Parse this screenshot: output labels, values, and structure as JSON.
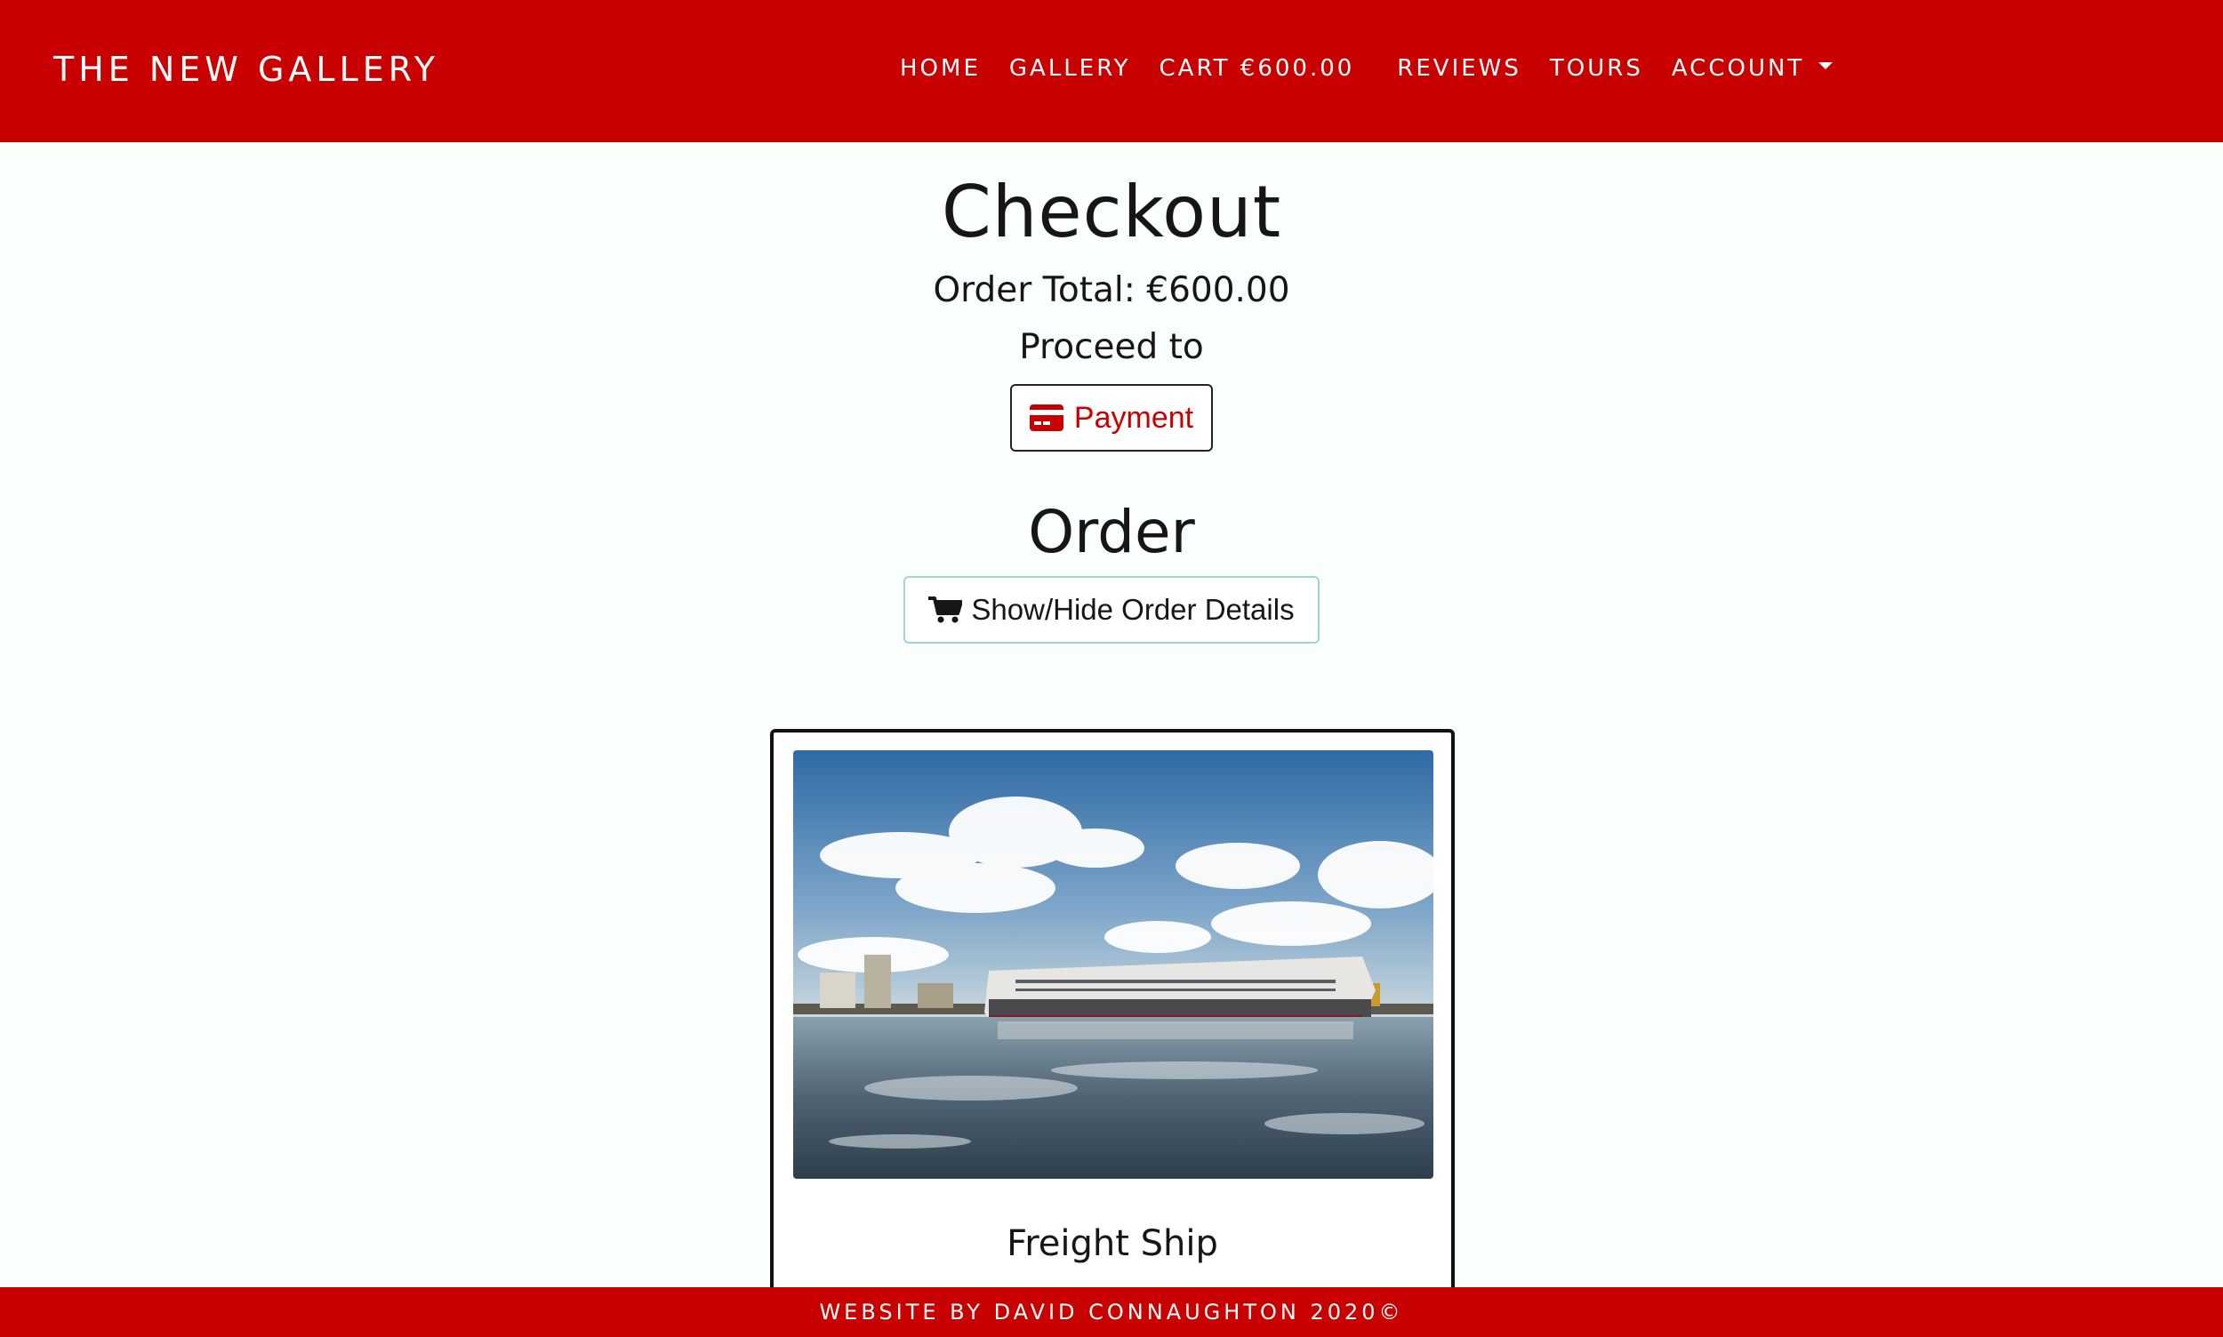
{
  "navbar": {
    "brand": "THE NEW GALLERY",
    "links": [
      {
        "label": "HOME"
      },
      {
        "label": "GALLERY"
      },
      {
        "label": "CART €600.00"
      },
      {
        "label": "REVIEWS"
      },
      {
        "label": "TOURS"
      },
      {
        "label": "ACCOUNT"
      }
    ]
  },
  "checkout": {
    "title": "Checkout",
    "order_total": "Order Total: €600.00",
    "proceed": "Proceed to",
    "payment_label": "Payment"
  },
  "order": {
    "title": "Order",
    "toggle_label": "Show/Hide Order Details",
    "items": [
      {
        "name": "Freight Ship",
        "image": "freight-ship-photo"
      }
    ]
  },
  "footer": {
    "text": "WEBSITE BY DAVID CONNAUGHTON 2020©"
  },
  "colors": {
    "brand_red": "#c80000",
    "page_bg": "#fbfffc",
    "toggle_border": "#9fd7cf"
  }
}
